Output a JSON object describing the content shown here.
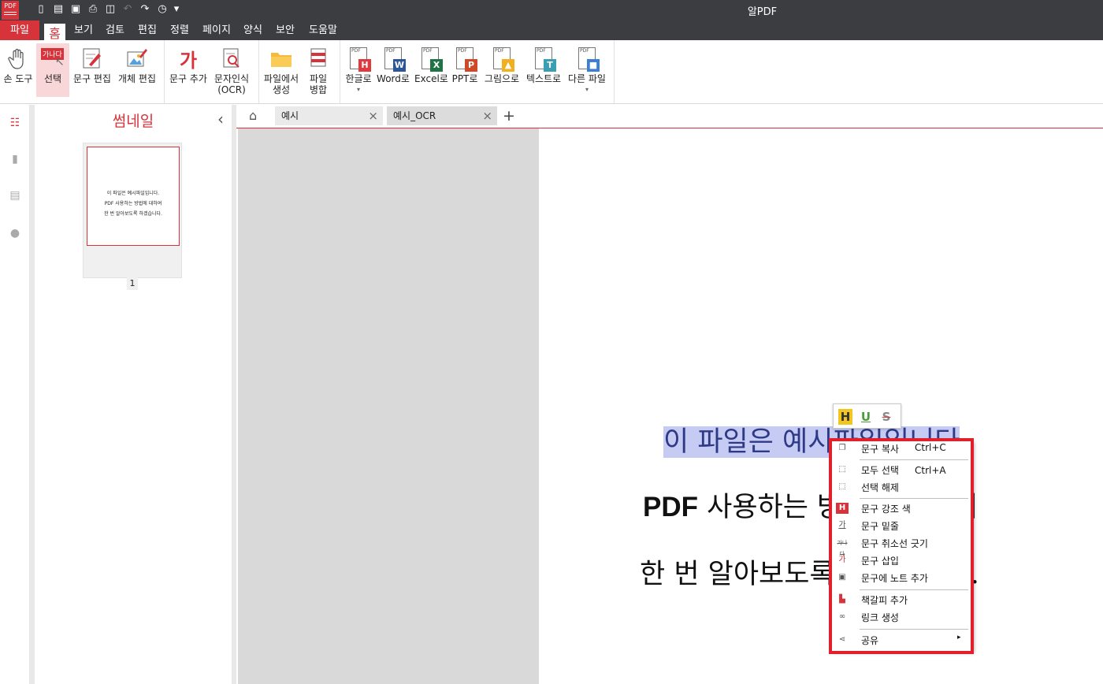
{
  "app": {
    "title": "알PDF",
    "logo_text": "PDF"
  },
  "quick_access": [
    "new-icon",
    "save-icon",
    "save-as-icon",
    "print-icon",
    "print-preview-icon",
    "undo-icon",
    "redo-icon",
    "history-icon",
    "more-icon"
  ],
  "menu": {
    "file": "파일",
    "tabs": [
      "홈",
      "보기",
      "검토",
      "편집",
      "정렬",
      "페이지",
      "양식",
      "보안",
      "도움말"
    ],
    "active": "홈"
  },
  "ribbon": {
    "hand_tool": "손 도구",
    "select": "선택",
    "select_badge": "가나다",
    "edit_text": "문구 편집",
    "edit_object": "개체 편집",
    "add_text": "문구 추가",
    "add_text_glyph": "가",
    "ocr_line1": "문자인식",
    "ocr_line2": "(OCR)",
    "create_line1": "파일에서",
    "create_line2": "생성",
    "merge_line1": "파일",
    "merge_line2": "병합",
    "to_hwp": "한글로",
    "to_word": "Word로",
    "to_excel": "Excel로",
    "to_ppt": "PPT로",
    "to_image": "그림으로",
    "to_text": "텍스트로",
    "to_other": "다른 파일",
    "pdf_tag": "PDF",
    "badge_hwp": "H",
    "badge_word": "W",
    "badge_excel": "X",
    "badge_ppt": "P",
    "badge_text": "T",
    "colors": {
      "hwp": "#e03a3e",
      "word": "#2b579a",
      "excel": "#217346",
      "ppt": "#d24726",
      "image": "#f2b01e",
      "text": "#3b9fb4"
    }
  },
  "thumbnail_panel": {
    "title": "썸네일",
    "page_lines": [
      "이 파일은 예시파일입니다.",
      "PDF 사용하는 방법에 대하여",
      "한 번 알아보도록 하겠습니다."
    ],
    "page_number": "1"
  },
  "tabs": [
    {
      "label": "예시",
      "active": false
    },
    {
      "label": "예시_OCR",
      "active": true
    }
  ],
  "document": {
    "line1_selected": "이 파일은 예시파일입니다",
    "line1_period": ".",
    "line2_bold": "PDF",
    "line2_rest": " 사용하는 방법에 대하여",
    "line3": "한 번 알아보도록 하겠습니다."
  },
  "mini_toolbar": {
    "highlight": "H",
    "underline": "U",
    "strikethrough": "S"
  },
  "context_menu": {
    "items": [
      {
        "label": "문구 복사",
        "shortcut": "Ctrl+C",
        "icon": "copy-icon"
      },
      {
        "label": "모두 선택",
        "shortcut": "Ctrl+A",
        "icon": "select-all-icon"
      },
      {
        "label": "선택 해제",
        "shortcut": "",
        "icon": "deselect-icon"
      },
      {
        "label": "문구 강조 색",
        "shortcut": "",
        "icon": "highlight-icon"
      },
      {
        "label": "문구 밑줄",
        "shortcut": "",
        "icon": "underline-icon"
      },
      {
        "label": "문구 취소선 긋기",
        "shortcut": "",
        "icon": "strikethrough-icon"
      },
      {
        "label": "문구 삽입",
        "shortcut": "",
        "icon": "insert-text-icon"
      },
      {
        "label": "문구에 노트 추가",
        "shortcut": "",
        "icon": "note-icon"
      },
      {
        "label": "책갈피 추가",
        "shortcut": "",
        "icon": "bookmark-icon"
      },
      {
        "label": "링크 생성",
        "shortcut": "",
        "icon": "link-icon"
      },
      {
        "label": "공유",
        "shortcut": "",
        "icon": "share-icon"
      }
    ],
    "icon_glyphs": {
      "highlight": "H",
      "underline": "가",
      "strikethrough": "가나다",
      "insert": "가"
    },
    "share_arrow": "▸"
  },
  "colors": {
    "accent": "#d6333b",
    "selection": "#c6cbf4",
    "outline": "#e0202a"
  }
}
